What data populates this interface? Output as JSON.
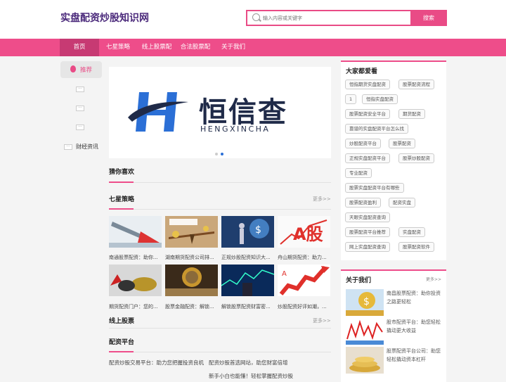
{
  "header": {
    "logo": "实盘配资炒股知识网",
    "search_placeholder": "输入内容或关键字",
    "search_button": "搜索"
  },
  "nav": {
    "items": [
      "首页",
      "七星策略",
      "线上股票配",
      "合法股票配",
      "关于我们"
    ],
    "active": "首页"
  },
  "leftnav": {
    "recommend": "推荐",
    "placeholder_items": [
      "···",
      "···",
      "···"
    ],
    "finance": "财经资讯"
  },
  "banner": {
    "brand_cn": "恒信查",
    "brand_en": "HENGXINCHA"
  },
  "sections": {
    "guess": "猜你喜欢",
    "qixing": "七星策略",
    "online": "线上股票",
    "peizi": "配资平台",
    "more": "更多>>"
  },
  "qixing_items": [
    "南通股票配资：助你...",
    "湖南期货配资公司排...",
    "正规炒股配资知识大...",
    "舟山期货配资：助力...",
    "期货配资门户：您的...",
    "股票金融配资：解锁...",
    "解锁股票配资财富密...",
    "炒股配资好评如潮，..."
  ],
  "peizi_items": [
    "配资炒股交易平台：助力您把握投资良机",
    "配资炒股首选网站，助您财富倍增",
    "新手小白也能懂！轻松掌握配资炒股"
  ],
  "popular": {
    "title": "大家都爱看",
    "tags": [
      "恒指期货实盘配资",
      "股票配资流程",
      "1",
      "恒指实盘配资",
      "股票配资安全平台",
      "期货配资",
      "靠谱的实盘配资平台怎么找",
      "炒股配资平台",
      "股票配资",
      "正规实盘配资平台",
      "股票炒股配资",
      "专业配资",
      "股票实盘配资平台有哪些",
      "股票配资盈利",
      "配资实盘",
      "天眼实盘配资查询",
      "股票配资平台推荐",
      "实盘配资",
      "网上实盘配资查询",
      "股票配资软件"
    ]
  },
  "about": {
    "title": "关于我们",
    "more": "更多>>",
    "items": [
      "南昌股票配资：助你投资之路更轻松",
      "股市配资平台：助您轻松撬动更大收益",
      "股票配资平台公司：助您轻松撬动资本杠杆"
    ]
  },
  "colors": {
    "accent": "#ee4d8a",
    "nav_active": "#c73a73",
    "logo": "#4b2a7b",
    "brand_blue": "#2b6fd6"
  },
  "icons": {
    "search": "search-icon",
    "recommend": "fire-icon"
  }
}
